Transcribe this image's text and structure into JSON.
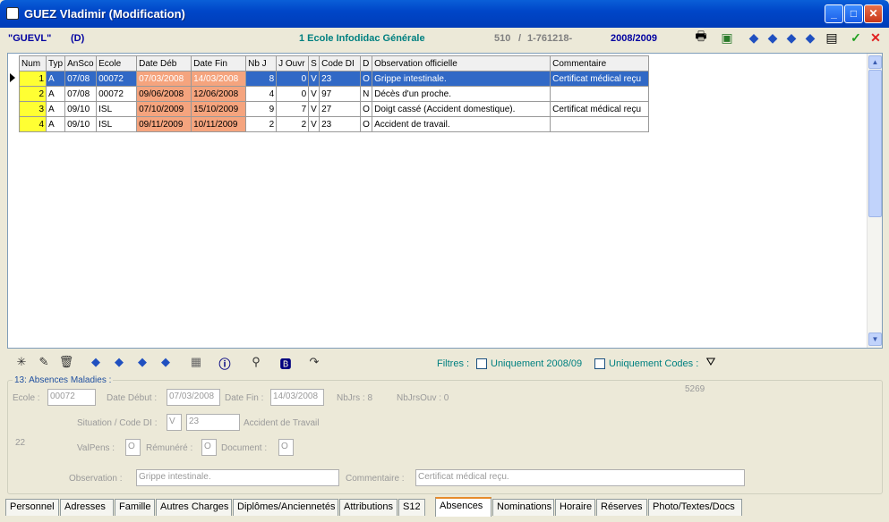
{
  "window": {
    "title": "GUEZ Vladimir (Modification)"
  },
  "header": {
    "code": "\"GUEVL\"",
    "flag": "(D)",
    "school": "1 Ecole Infodidac Générale",
    "num1": "510",
    "sep": "/",
    "num2": "1-761218-",
    "year": "2008/2009"
  },
  "grid": {
    "columns": [
      "Num",
      "Typ",
      "AnSco",
      "Ecole",
      "Date Déb",
      "Date Fin",
      "Nb J",
      "J Ouvr",
      "S",
      "Code DI",
      "D",
      "Observation officielle",
      "Commentaire"
    ],
    "rows": [
      [
        "1",
        "A",
        "07/08",
        "00072",
        "07/03/2008",
        "14/03/2008",
        "8",
        "0",
        "V",
        "23",
        "O",
        "Grippe intestinale.",
        "Certificat médical reçu"
      ],
      [
        "2",
        "A",
        "07/08",
        "00072",
        "09/06/2008",
        "12/06/2008",
        "4",
        "0",
        "V",
        "97",
        "N",
        "Décès d'un proche.",
        ""
      ],
      [
        "3",
        "A",
        "09/10",
        "ISL",
        "07/10/2009",
        "15/10/2009",
        "9",
        "7",
        "V",
        "27",
        "O",
        "Doigt cassé (Accident domestique).",
        "Certificat médical reçu"
      ],
      [
        "4",
        "A",
        "09/10",
        "ISL",
        "09/11/2009",
        "10/11/2009",
        "2",
        "2",
        "V",
        "23",
        "O",
        "Accident de travail.",
        ""
      ]
    ]
  },
  "filters": {
    "label": "Filtres :",
    "opt1": "Uniquement 2008/09",
    "opt2": "Uniquement Codes :"
  },
  "detail": {
    "section": "13: Absences Maladies :",
    "ecole_lbl": "Ecole :",
    "ecole": "00072",
    "datedeb_lbl": "Date Début :",
    "datedeb": "07/03/2008",
    "datefin_lbl": "Date Fin :",
    "datefin": "14/03/2008",
    "nbjrs": "NbJrs :  8",
    "nbjrsouv": "NbJrsOuv :  0",
    "ref": "5269",
    "situation_lbl": "Situation / Code DI :",
    "situation": "V",
    "codedi": "23",
    "codedi_text": "Accident de Travail",
    "side_num": "22",
    "valpens_lbl": "ValPens :",
    "valpens": "O",
    "remunere_lbl": "Rémunéré :",
    "remunere": "O",
    "document_lbl": "Document :",
    "document": "O",
    "observation_lbl": "Observation :",
    "observation": "Grippe intestinale.",
    "commentaire_lbl": "Commentaire :",
    "commentaire": "Certificat médical reçu."
  },
  "tabs": [
    "Personnel",
    "Adresses",
    "Famille",
    "Autres Charges",
    "Diplômes/Anciennetés",
    "Attributions",
    "S12",
    "Absences",
    "Nominations",
    "Horaire",
    "Réserves",
    "Photo/Textes/Docs"
  ]
}
